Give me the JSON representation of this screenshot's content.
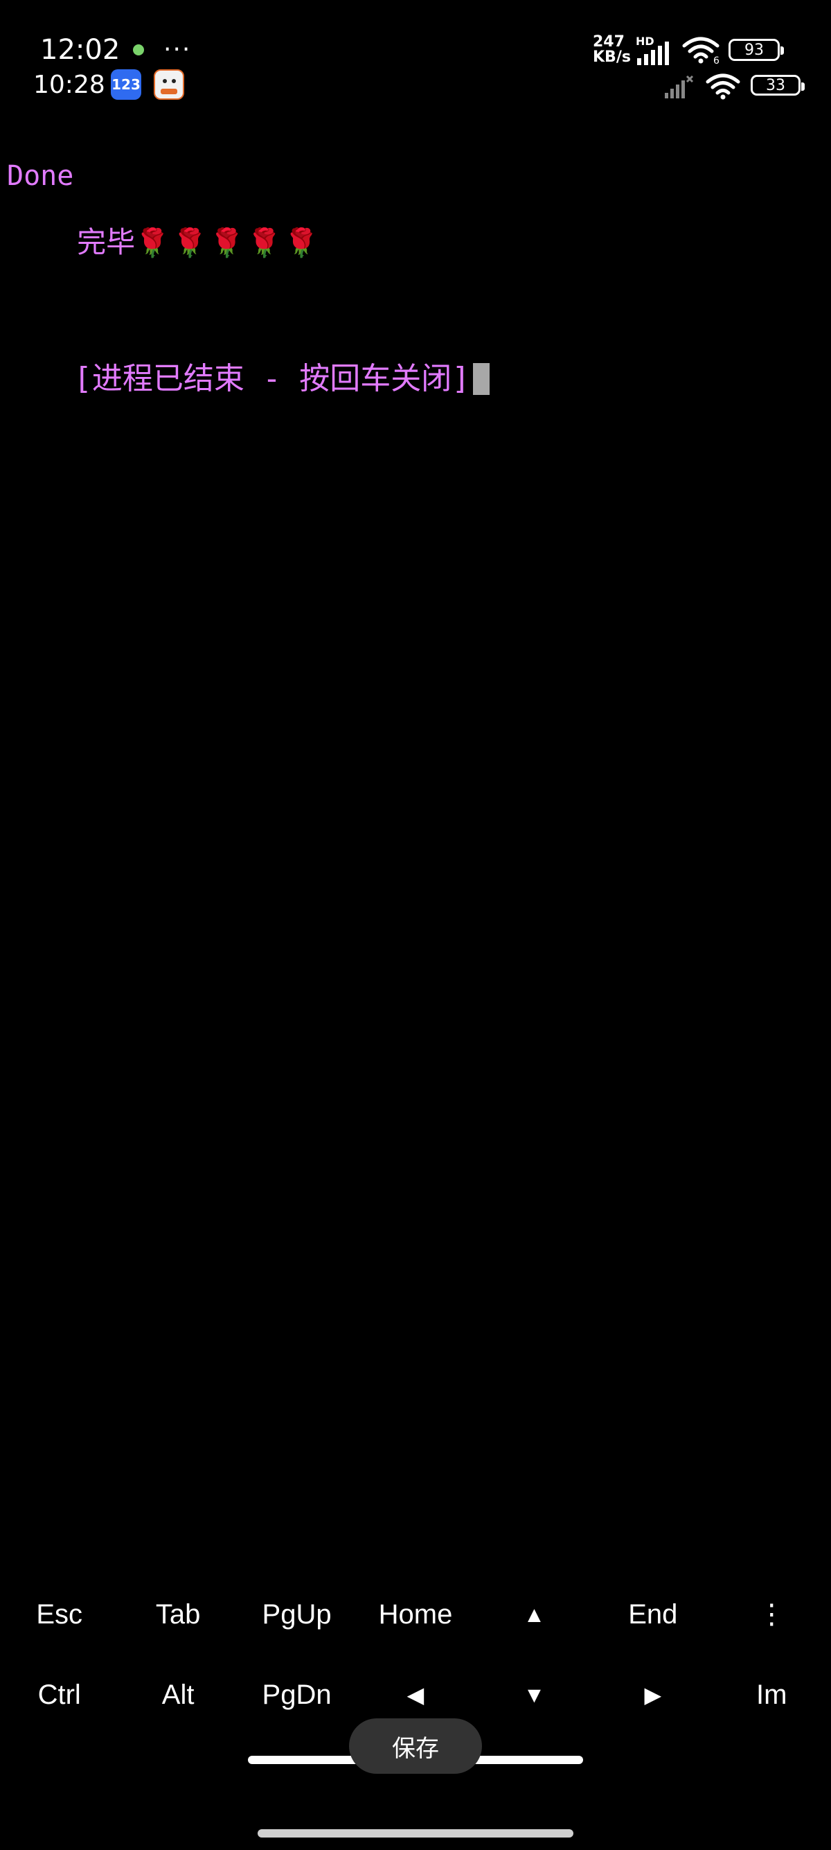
{
  "status_bar": {
    "time_primary": "12:02",
    "more_glyph": "···",
    "time_secondary": "10:28",
    "app_icon_1_label": "123",
    "net_speed_value": "247",
    "net_speed_unit": "KB/s",
    "hd_label": "HD",
    "signal_sub": "6",
    "battery_primary": "93",
    "battery_secondary": "33",
    "accent_green": "#7ad36b"
  },
  "terminal": {
    "line_1": "Done",
    "line_2_text": "完毕",
    "line_2_roses": "🌹🌹🌹🌹🌹",
    "message": "[进程已结束 - 按回车关闭]",
    "text_color": "#e27bff"
  },
  "extra_keys": {
    "row_1": [
      "Esc",
      "Tab",
      "PgUp",
      "Home",
      "▲",
      "End",
      "⋮"
    ],
    "row_2": [
      "Ctrl",
      "Alt",
      "PgDn",
      "◀",
      "▼",
      "▶",
      "Im"
    ]
  },
  "overlay": {
    "save_label": "保存"
  }
}
